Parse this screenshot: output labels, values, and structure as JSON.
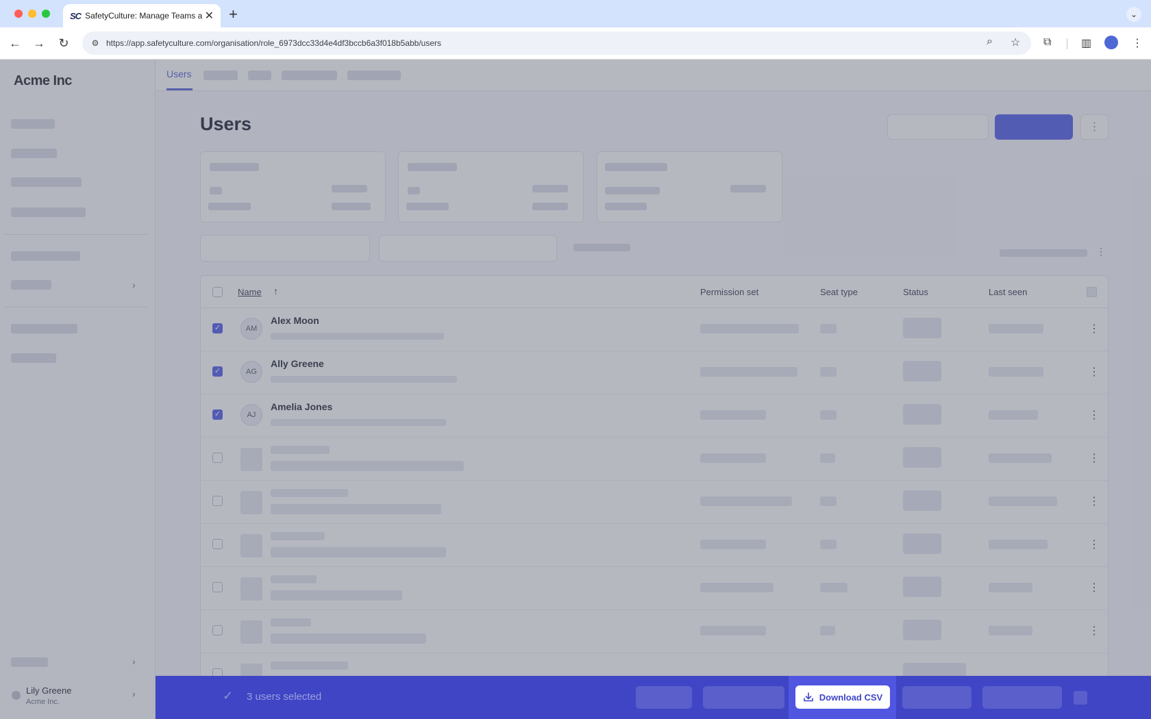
{
  "browser": {
    "tab_favicon": "SC",
    "tab_title": "SafetyCulture: Manage Teams and...",
    "tab_close": "✕",
    "new_tab": "+",
    "url": "https://app.safetyculture.com/organisation/role_6973dcc33d4e4df3bccb6a3f018b5abb/users"
  },
  "sidebar": {
    "brand": "Acme Inc",
    "user_name": "Lily Greene",
    "user_org": "Acme Inc."
  },
  "topnav": {
    "active_tab": "Users"
  },
  "page": {
    "title": "Users"
  },
  "table": {
    "columns": [
      "Name",
      "Permission set",
      "Seat type",
      "Status",
      "Last seen"
    ],
    "rows": [
      {
        "initials": "AM",
        "name": "Alex Moon",
        "checked": true
      },
      {
        "initials": "AG",
        "name": "Ally Greene",
        "checked": true
      },
      {
        "initials": "AJ",
        "name": "Amelia Jones",
        "checked": true
      }
    ]
  },
  "bulk_bar": {
    "selected_text": "3 users selected",
    "download_label": "Download CSV"
  },
  "colors": {
    "accent": "#5561e8",
    "bulk_bar": "#3f45c4"
  }
}
